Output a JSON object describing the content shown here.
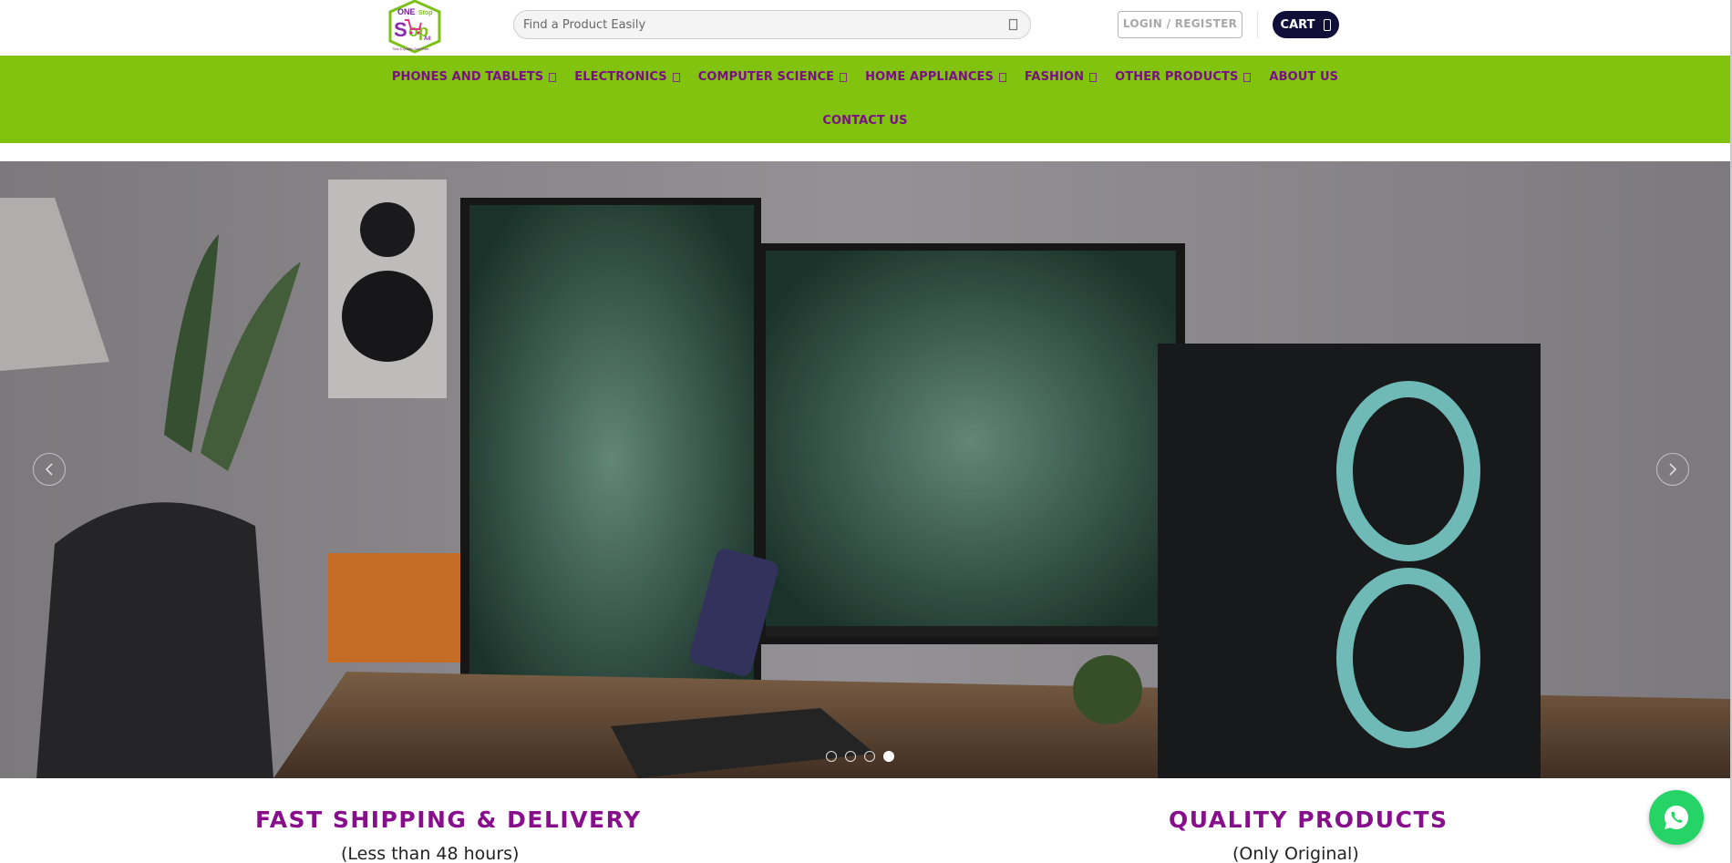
{
  "header": {
    "logo_text": "ONE Stop Shop All",
    "logo_tagline": "Time & Quality Over Price",
    "search_placeholder": "Find a Product Easily",
    "login_label": "LOGIN / REGISTER",
    "cart_label": "CART"
  },
  "nav": {
    "items": [
      {
        "label": "PHONES AND TABLETS",
        "dropdown": true
      },
      {
        "label": "ELECTRONICS",
        "dropdown": true
      },
      {
        "label": "COMPUTER SCIENCE",
        "dropdown": true
      },
      {
        "label": "HOME APPLIANCES",
        "dropdown": true
      },
      {
        "label": "FASHION",
        "dropdown": true
      },
      {
        "label": "OTHER PRODUCTS",
        "dropdown": true
      },
      {
        "label": "ABOUT US",
        "dropdown": false
      },
      {
        "label": "CONTACT US",
        "dropdown": false
      }
    ]
  },
  "slider": {
    "slide_count": 4,
    "active_slide": 4
  },
  "features": [
    {
      "title": "FAST SHIPPING & DELIVERY",
      "subtitle": "(Less than 48 hours)"
    },
    {
      "title": "QUALITY PRODUCTS",
      "subtitle": "(Only Original)"
    }
  ],
  "colors": {
    "brand_purple": "#870f8c",
    "nav_green": "#82c30f",
    "cart_navy": "#0f0f3a",
    "whatsapp_green": "#25d366"
  }
}
